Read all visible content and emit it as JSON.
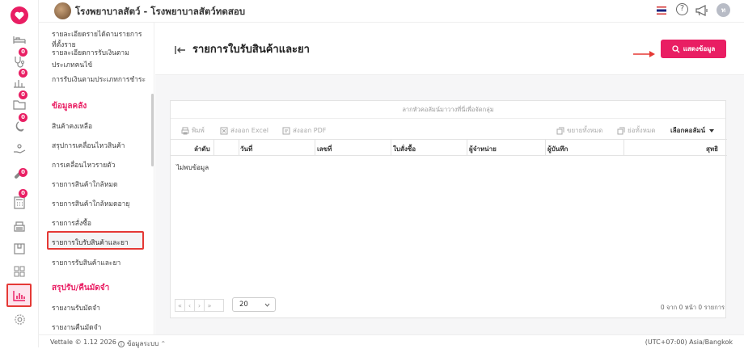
{
  "header": {
    "hospital_title": "โรงพยาบาลสัตว์ - โรงพยาบาลสัตว์ทดสอบ",
    "user_initial": "ท"
  },
  "rail": {
    "badges": [
      "0",
      "0",
      "0",
      "0",
      "0",
      "0"
    ]
  },
  "submenu": {
    "top_items": [
      "รายละเอียดรายได้ตามรายการ",
      "ที่ตั้งราย",
      "รายละเอียดการรับเงินตาม",
      "ประเภทคนไข้",
      "การรับเงินตามประเภทการชำระ"
    ],
    "section_stock": "ข้อมูลคลัง",
    "stock_items": [
      "สินค้าคงเหลือ",
      "สรุปการเคลื่อนไหวสินค้า",
      "การเคลื่อนไหวรายตัว",
      "รายการสินค้าใกล้หมด",
      "รายการสินค้าใกล้หมดอายุ",
      "รายการสั่งซื้อ",
      "รายการใบรับสินค้าและยา",
      "รายการรับสินค้าและยา"
    ],
    "section_deposit": "สรุปรับ/คืนมัดจำ",
    "deposit_items": [
      "รายงานรับมัดจำ",
      "รายงานคืนมัดจำ"
    ]
  },
  "page": {
    "title": "รายการใบรับสินค้าและยา",
    "show_button": "แสดงข้อมูล"
  },
  "grid": {
    "group_hint": "ลากหัวคอลัมน์มาวางที่นี่เพื่อจัดกลุ่ม",
    "print": "พิมพ์",
    "export_excel": "ส่งออก Excel",
    "export_pdf": "ส่งออก PDF",
    "expand_all": "ขยายทั้งหมด",
    "collapse_all": "ย่อทั้งหมด",
    "choose_columns": "เลือกคอลัมน์",
    "columns": [
      "ลำดับ",
      "วันที่",
      "เลขที่",
      "ใบสั่งซื้อ",
      "ผู้จำหน่าย",
      "ผู้บันทึก",
      "สุทธิ"
    ],
    "no_data": "ไม่พบข้อมูล",
    "page_size": "20",
    "pager_info": "0 จาก 0 หน้า 0 รายการ"
  },
  "footer": {
    "version": "Vettale © 1.12 2026",
    "system_info": "ข้อมูลระบบ",
    "timezone": "(UTC+07:00) Asia/Bangkok"
  },
  "colors": {
    "accent": "#e91e63",
    "highlight_box": "#e53935"
  }
}
